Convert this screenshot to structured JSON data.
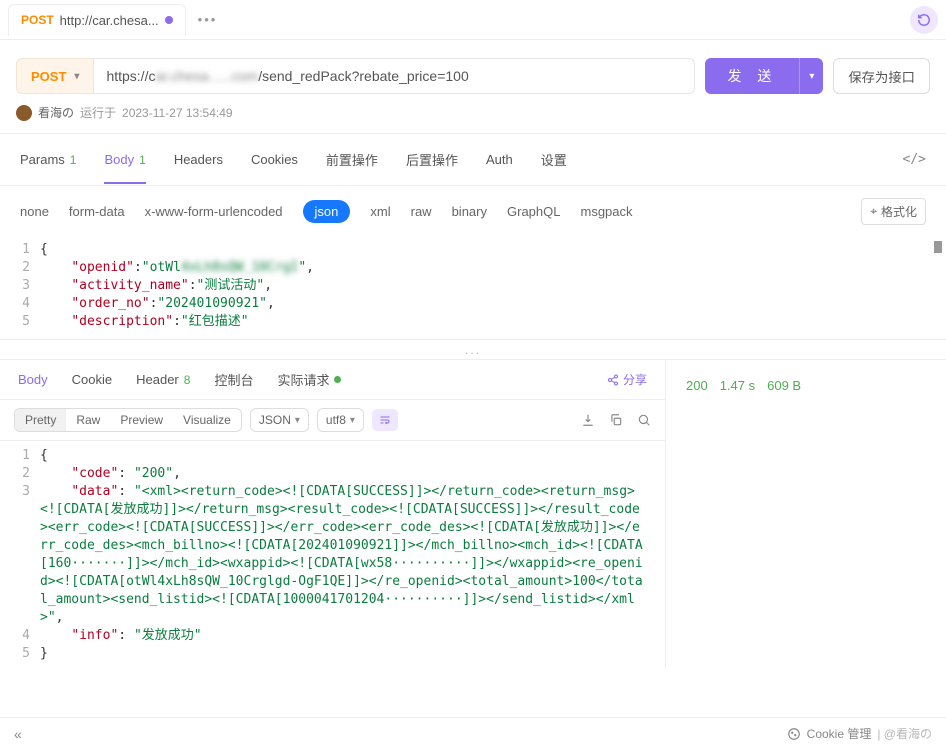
{
  "tab": {
    "method": "POST",
    "label": "http://car.chesa..."
  },
  "request": {
    "method": "POST",
    "url_prefix": "https://c",
    "url_mid_blur": "ar.chesa......com",
    "url_suffix": "/send_redPack?rebate_price=100",
    "send": "发 送",
    "save": "保存为接口"
  },
  "meta": {
    "user": "看海の",
    "run_label": "运行于",
    "timestamp": "2023-11-27 13:54:49"
  },
  "main_tabs": {
    "params": "Params",
    "params_n": "1",
    "body": "Body",
    "body_n": "1",
    "headers": "Headers",
    "cookies": "Cookies",
    "pre": "前置操作",
    "post": "后置操作",
    "auth": "Auth",
    "settings": "设置"
  },
  "body_types": {
    "none": "none",
    "form": "form-data",
    "xform": "x-www-form-urlencoded",
    "json": "json",
    "xml": "xml",
    "raw": "raw",
    "binary": "binary",
    "graphql": "GraphQL",
    "msgpack": "msgpack"
  },
  "format_btn": "格式化",
  "req_body": {
    "l1": "{",
    "l2_k": "\"openid\"",
    "l2_v_pre": "\"otWl",
    "l2_v_blur": "4xLh8sQW_10CrgI",
    "l2_v_post": "\"",
    "l3_k": "\"activity_name\"",
    "l3_v": "\"测试活动\"",
    "l4_k": "\"order_no\"",
    "l4_v": "\"202401090921\"",
    "l5_k": "\"description\"",
    "l5_v": "\"红包描述\""
  },
  "resp_tabs": {
    "body": "Body",
    "cookie": "Cookie",
    "header": "Header",
    "header_n": "8",
    "console": "控制台",
    "actual": "实际请求",
    "share": "分享"
  },
  "view": {
    "pretty": "Pretty",
    "raw": "Raw",
    "preview": "Preview",
    "visualize": "Visualize",
    "fmt": "JSON",
    "enc": "utf8"
  },
  "response": {
    "l1": "{",
    "l2_k": "\"code\"",
    "l2_v": "\"200\"",
    "l3_k": "\"data\"",
    "l3_v": "\"<xml><return_code><![CDATA[SUCCESS]]></return_code><return_msg><![CDATA[发放成功]]></return_msg><result_code><![CDATA[SUCCESS]]></result_code><err_code><![CDATA[SUCCESS]]></err_code><err_code_des><![CDATA[发放成功]]></err_code_des><mch_billno><![CDATA[202401090921]]></mch_billno><mch_id><![CDATA[160·······]]></mch_id><wxappid><![CDATA[wx58··········]]></wxappid><re_openid><![CDATA[otWl4xLh8sQW_10Crglgd-OgF1QE]]></re_openid><total_amount>100</total_amount><send_listid><![CDATA[1000041701204··········]]></send_listid></xml>\"",
    "l4_k": "\"info\"",
    "l4_v": "\"发放成功\"",
    "l5": "}"
  },
  "stats": {
    "status": "200",
    "time": "1.47 s",
    "size": "609 B"
  },
  "footer": {
    "collapse": "«",
    "cookie": "Cookie 管理",
    "watermark": "| @看海の"
  }
}
